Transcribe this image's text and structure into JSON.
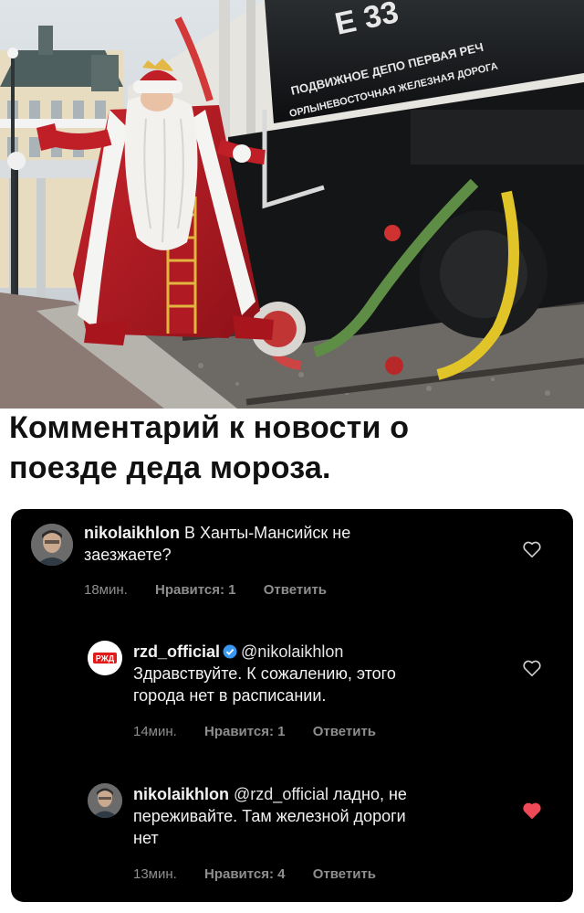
{
  "photo": {
    "plate_line1": "Е 33",
    "plate_line2": "ПОДВИЖНОЕ ДЕПО ПЕРВАЯ РЕЧ",
    "plate_line3": "ОРЛЫНЕВОСТОЧНАЯ ЖЕЛЕЗНАЯ ДОРОГА"
  },
  "caption": {
    "line1": "Комментарий к новости о",
    "line2": "поезде деда мороза."
  },
  "comments": [
    {
      "username": "nikolaikhlon",
      "text_part1": " В Ханты-Мансийск не",
      "text_part2": "заезжаете?",
      "time": "18мин.",
      "likes": "Нравится: 1",
      "reply": "Ответить",
      "liked": false
    },
    {
      "username": "rzd_official",
      "mention": "@nikolaikhlon",
      "text_line1": "Здравствуйте. К сожалению, этого",
      "text_line2": "города нет в расписании.",
      "time": "14мин.",
      "likes": "Нравится: 1",
      "reply": "Ответить",
      "liked": false,
      "avatar_logo": "РЖД"
    },
    {
      "username": "nikolaikhlon",
      "mention": "@rzd_official",
      "text_part1": " ладно, не",
      "text_line2": "переживайте. Там железной дороги",
      "text_line3": "нет",
      "time": "13мин.",
      "likes": "Нравится: 4",
      "reply": "Ответить",
      "liked": true
    }
  ],
  "colors": {
    "card_bg": "#000000",
    "meta_text": "#8e8e8e",
    "liked_heart": "#ed4956",
    "verified_badge": "#3897f0",
    "rzd_red": "#e21a1a"
  }
}
